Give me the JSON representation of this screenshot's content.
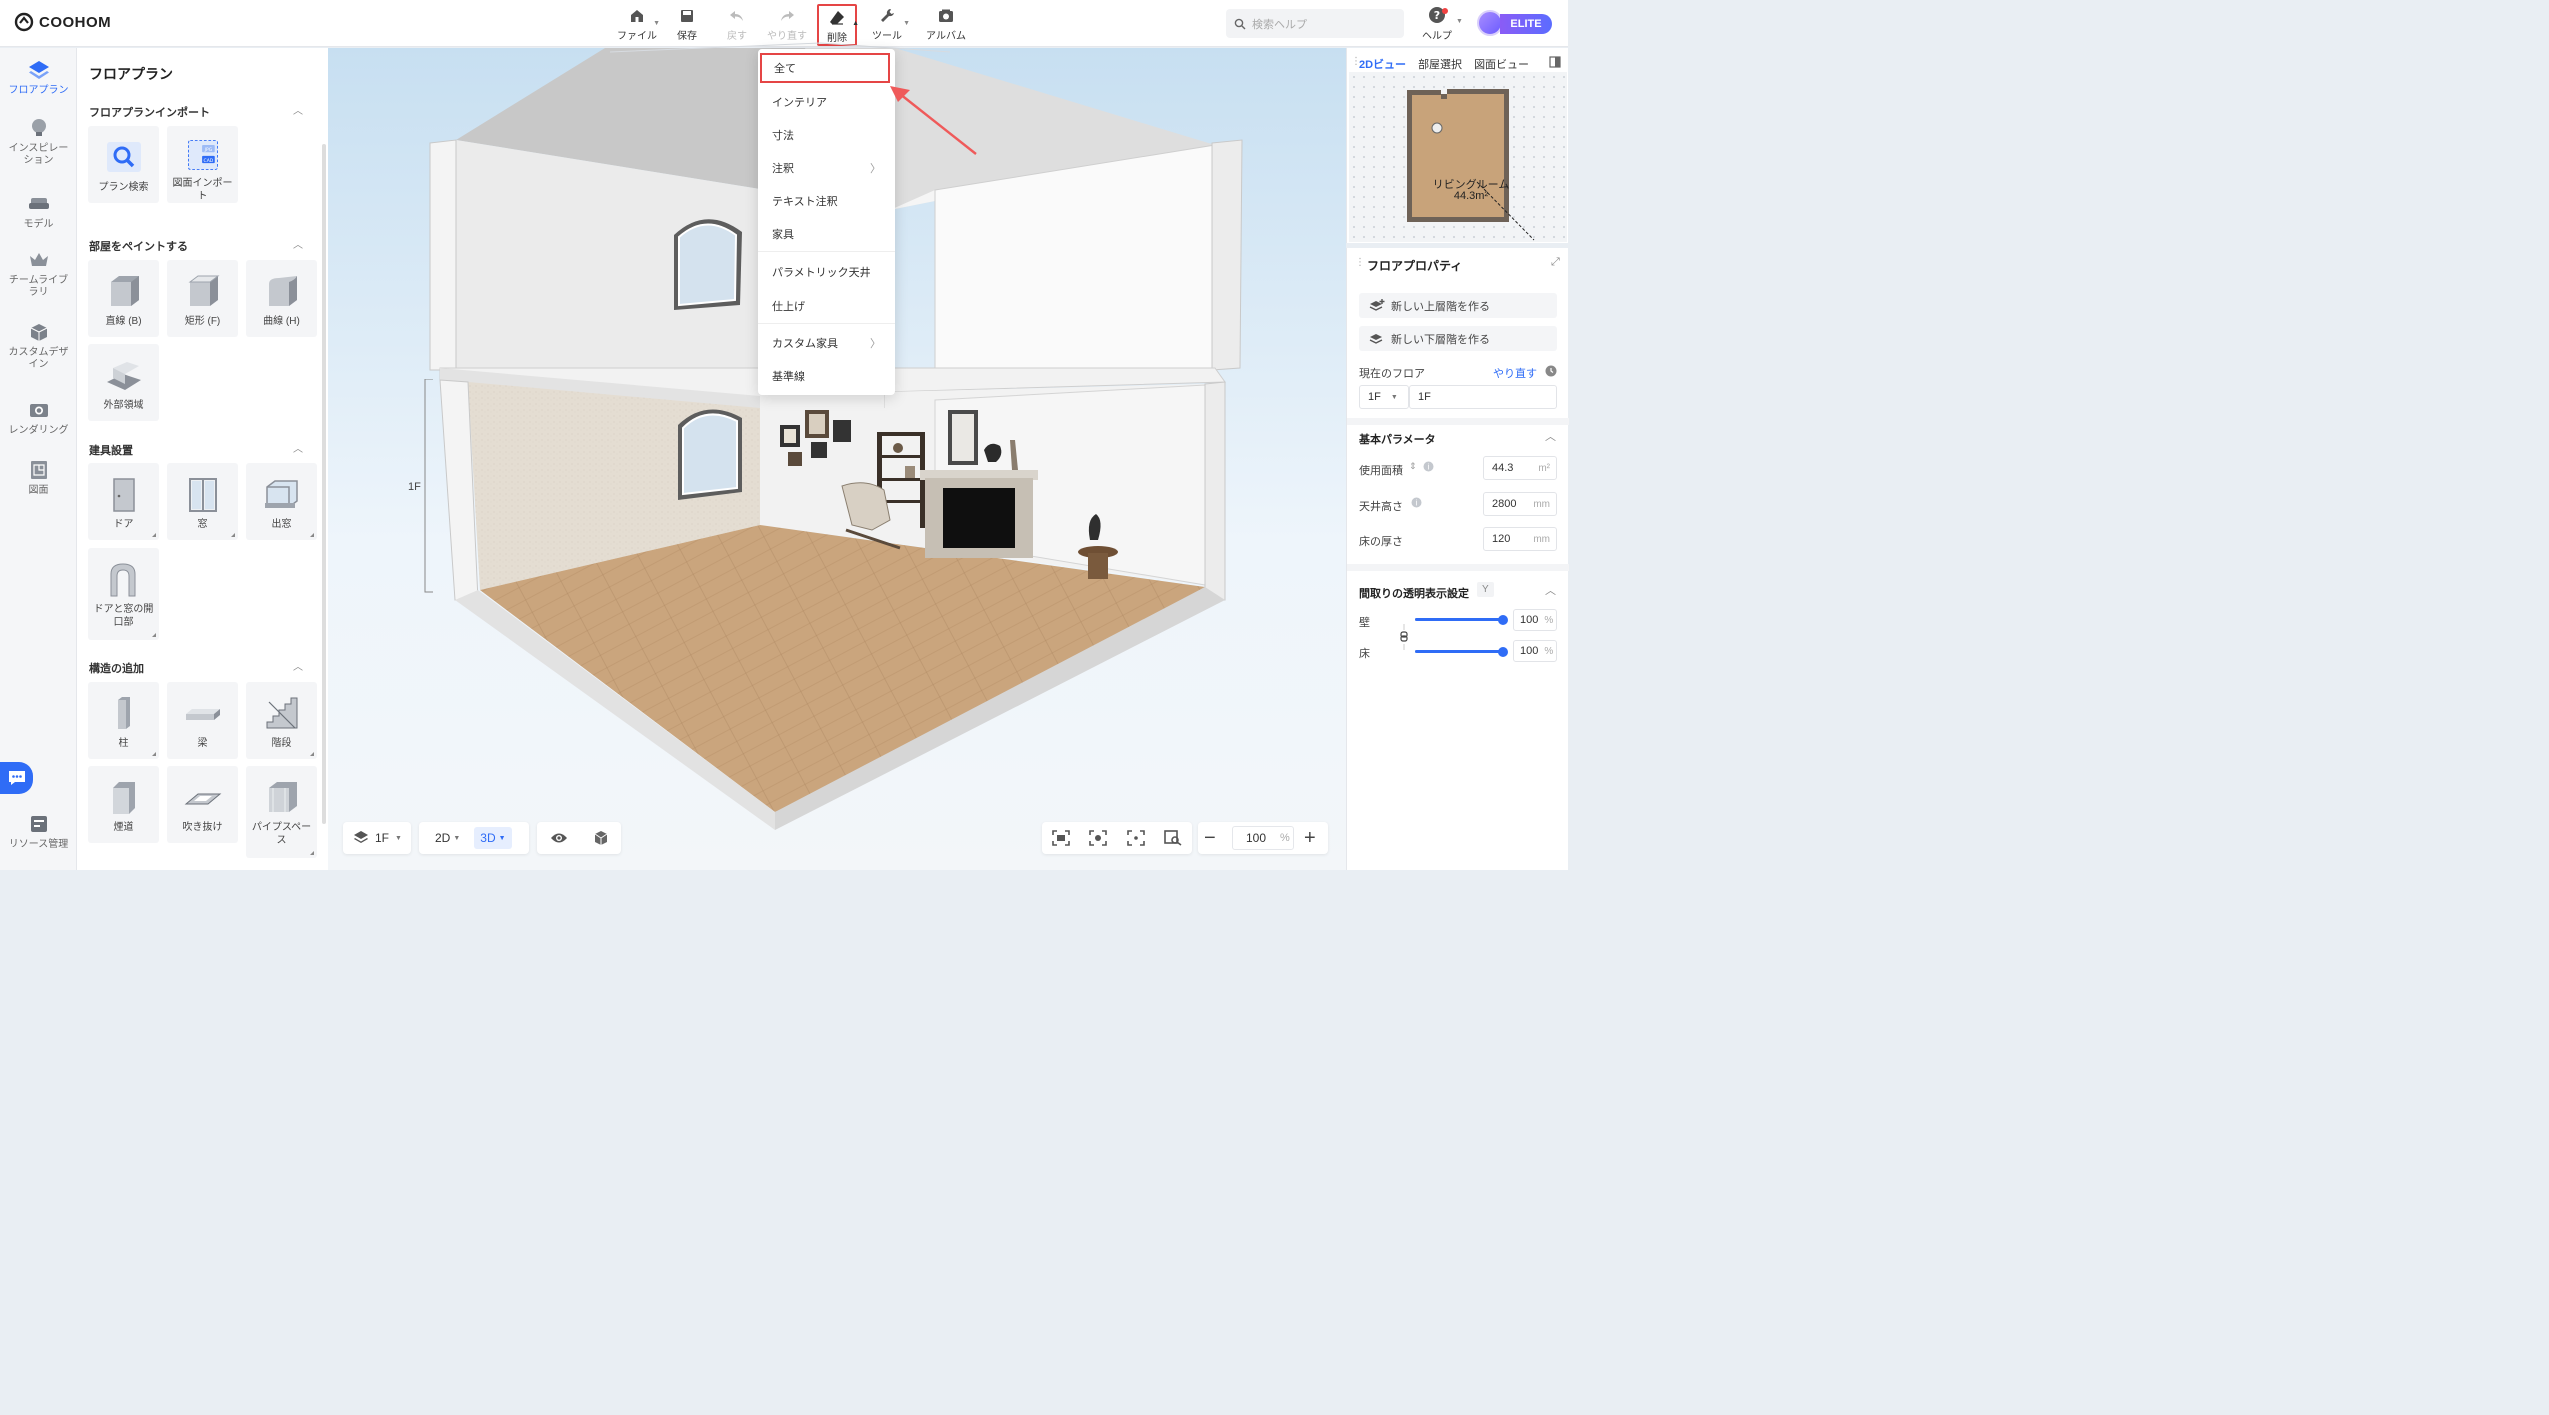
{
  "app": {
    "brand": "COOHOM"
  },
  "toolbar": {
    "file": "ファイル",
    "save": "保存",
    "undo": "戻す",
    "redo": "やり直す",
    "delete": "削除",
    "tools": "ツール",
    "album": "アルバム"
  },
  "search": {
    "placeholder": "検索ヘルプ"
  },
  "help": {
    "label": "ヘルプ"
  },
  "account": {
    "badge": "ELITE"
  },
  "rail": {
    "items": [
      {
        "label": "フロアプラン"
      },
      {
        "label": "インスピレーション"
      },
      {
        "label": "モデル"
      },
      {
        "label": "チームライブラリ"
      },
      {
        "label": "カスタムデザイン"
      },
      {
        "label": "レンダリング"
      },
      {
        "label": "図面"
      },
      {
        "label": "リソース管理"
      }
    ]
  },
  "panel": {
    "title": "フロアプラン",
    "sections": [
      {
        "title": "フロアプランインポート",
        "items": [
          "プラン検索",
          "図面インポート"
        ]
      },
      {
        "title": "部屋をペイントする",
        "items": [
          "直線 (B)",
          "矩形 (F)",
          "曲線 (H)",
          "外部領域"
        ]
      },
      {
        "title": "建具設置",
        "items": [
          "ドア",
          "窓",
          "出窓",
          "ドアと窓の開口部"
        ]
      },
      {
        "title": "構造の追加",
        "items": [
          "柱",
          "梁",
          "階段",
          "煙道",
          "吹き抜け",
          "パイプスペース"
        ]
      }
    ],
    "tile_tags": {
      "jpg": "JPG",
      "cad": "CAD"
    }
  },
  "viewport": {
    "level_label": "1F",
    "floor_select": "1F",
    "view_2d": "2D",
    "view_3d": "3D",
    "zoom": "100",
    "zoom_unit": "%"
  },
  "delete_menu": {
    "items": [
      "全て",
      "インテリア",
      "寸法",
      "注釈",
      "テキスト注釈",
      "家具",
      "パラメトリック天井",
      "仕上げ",
      "カスタム家具",
      "基準線"
    ]
  },
  "minimap": {
    "tabs": [
      "2Dビュー",
      "部屋選択",
      "図面ビュー"
    ],
    "room_name": "リビングルーム",
    "room_area": "44.3m²"
  },
  "props": {
    "title": "フロアプロパティ",
    "new_upper": "新しい上層階を作る",
    "new_lower": "新しい下層階を作る",
    "current_floor_label": "現在のフロア",
    "redo_link": "やり直す",
    "floor_code": "1F",
    "floor_name": "1F",
    "basic_params": "基本パラメータ",
    "usable_area_label": "使用面積",
    "usable_area": "44.3",
    "usable_area_unit": "m²",
    "ceiling_height_label": "天井高さ",
    "ceiling_height": "2800",
    "floor_thickness_label": "床の厚さ",
    "floor_thickness": "120",
    "unit_mm": "mm",
    "transparency_title": "間取りの透明表示設定",
    "transparency_key": "Y",
    "wall_label": "壁",
    "wall_value": "100",
    "floor_label": "床",
    "floor_value": "100",
    "percent": "%"
  },
  "colors": {
    "accent": "#2f6cf6",
    "highlight": "#e54545",
    "floor_wood": "#c9a27a"
  }
}
